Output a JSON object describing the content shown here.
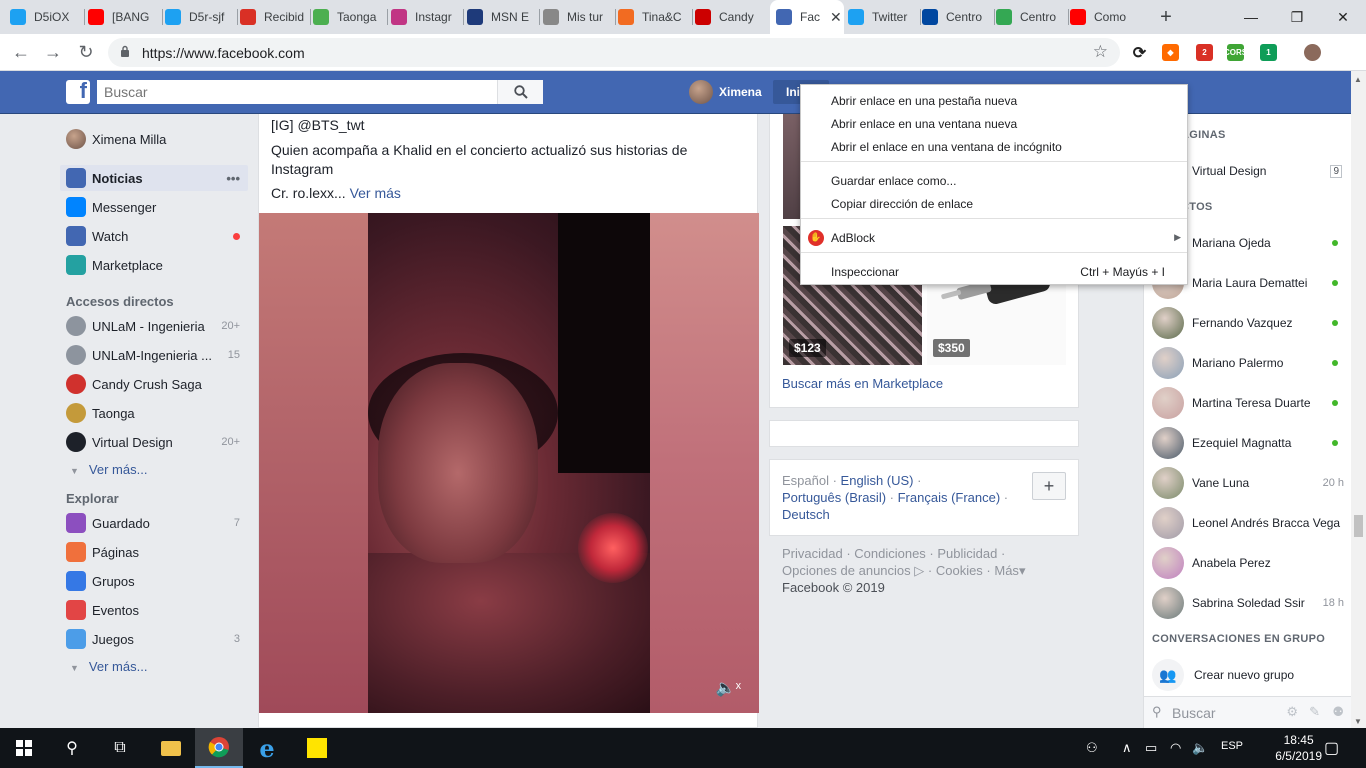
{
  "browser": {
    "tabs": [
      {
        "title": "D5iOX",
        "icon": "twitter-icon",
        "color": "#1da1f2"
      },
      {
        "title": "[BANG",
        "icon": "youtube-icon",
        "color": "#ff0000"
      },
      {
        "title": "D5r-sjf",
        "icon": "twitter-icon",
        "color": "#1da1f2"
      },
      {
        "title": "Recibid",
        "icon": "gmail-icon",
        "color": "#d93025"
      },
      {
        "title": "Taonga",
        "icon": "taonga-icon",
        "color": "#4caf50"
      },
      {
        "title": "Instagr",
        "icon": "instagram-icon",
        "color": "#c13584"
      },
      {
        "title": "MSN E",
        "icon": "msn-icon",
        "color": "#1e3a7a"
      },
      {
        "title": "Mis tur",
        "icon": "page-icon",
        "color": "#888888"
      },
      {
        "title": "Tina&C",
        "icon": "tina-icon",
        "color": "#f26b21"
      },
      {
        "title": "Candy",
        "icon": "santander-icon",
        "color": "#cc0000"
      },
      {
        "title": "Fac",
        "icon": "facebook-icon",
        "color": "#4267b2",
        "active": true,
        "close": "✕"
      },
      {
        "title": "Twitter",
        "icon": "twitter-icon",
        "color": "#1da1f2"
      },
      {
        "title": "Centro",
        "icon": "korea-icon",
        "color": "#0047a0"
      },
      {
        "title": "Centro",
        "icon": "maps-icon",
        "color": "#34a853"
      },
      {
        "title": "Como",
        "icon": "youtube-icon",
        "color": "#ff0000"
      }
    ],
    "new_tab": "+",
    "window_controls": {
      "minimize": "—",
      "maximize": "❐",
      "close": "✕"
    },
    "url": "https://www.facebook.com",
    "extensions": [
      {
        "name": "sync-icon",
        "color": "#222222",
        "label": "⟳"
      },
      {
        "name": "orange-ext-icon",
        "color": "#ff6a00",
        "label": "◆"
      },
      {
        "name": "red-ext-icon",
        "color": "#d93025",
        "label": "2"
      },
      {
        "name": "cors-icon",
        "color": "#3fa535",
        "label": "CORS"
      },
      {
        "name": "green-ext-icon",
        "color": "#0f9d58",
        "label": "1"
      },
      {
        "name": "profile-avatar-icon",
        "color": "#8b6a5c",
        "label": ""
      }
    ]
  },
  "fb": {
    "search_placeholder": "Buscar",
    "profile_name": "Ximena",
    "home_label": "Inicio"
  },
  "leftnav": {
    "user": "Ximena Milla",
    "main": [
      {
        "label": "Noticias",
        "icon": "newsfeed-icon",
        "color": "#4267b2",
        "extra": "•••",
        "selected": true
      },
      {
        "label": "Messenger",
        "icon": "messenger-icon",
        "color": "#0084ff"
      },
      {
        "label": "Watch",
        "icon": "watch-icon",
        "color": "#4267b2",
        "dot": true
      },
      {
        "label": "Marketplace",
        "icon": "marketplace-icon",
        "color": "#24a1a1"
      }
    ],
    "shortcuts_title": "Accesos directos",
    "shortcuts": [
      {
        "label": "UNLaM - Ingenieria",
        "icon": "group-icon",
        "color": "#8d949e",
        "count": "20+"
      },
      {
        "label": "UNLaM-Ingenieria ...",
        "icon": "group-icon",
        "color": "#8d949e",
        "count": "15"
      },
      {
        "label": "Candy Crush Saga",
        "icon": "candy-crush-icon",
        "color": "#d0312d"
      },
      {
        "label": "Taonga",
        "icon": "taonga-icon",
        "color": "#c49a3a"
      },
      {
        "label": "Virtual Design",
        "icon": "virtual-design-icon",
        "color": "#1d2129",
        "count": "20+"
      }
    ],
    "ver_mas": "Ver más...",
    "explore_title": "Explorar",
    "explore": [
      {
        "label": "Guardado",
        "icon": "saved-icon",
        "color": "#8c4fbf",
        "count": "7"
      },
      {
        "label": "Páginas",
        "icon": "pages-icon",
        "color": "#f0703c"
      },
      {
        "label": "Grupos",
        "icon": "groups-icon",
        "color": "#3578e5"
      },
      {
        "label": "Eventos",
        "icon": "events-icon",
        "color": "#e24545"
      },
      {
        "label": "Juegos",
        "icon": "games-icon",
        "color": "#4c9de8",
        "count": "3"
      }
    ],
    "ver_mas2": "Ver más..."
  },
  "post": {
    "line1": "[IG] @BTS_twt",
    "line2": "Quien acompaña a Khalid en el concierto actualizó sus historias de Instagram",
    "line3": "Cr. ro.lexx...",
    "more": "Ver más"
  },
  "marketplace": {
    "prices": [
      "$123",
      "$350"
    ],
    "link": "Buscar más en Marketplace"
  },
  "languages": {
    "current": "Español",
    "links": [
      "English (US)",
      "Português (Brasil)",
      "Français (France)",
      "Deutsch"
    ],
    "plus": "+"
  },
  "footer": {
    "links": [
      "Privacidad",
      "Condiciones",
      "Publicidad",
      "Opciones de anuncios",
      "Cookies",
      "Más"
    ],
    "copyright": "Facebook © 2019"
  },
  "rightbar": {
    "pages_title": "ÁGINAS",
    "page": {
      "name": "Virtual Design",
      "count": "9"
    },
    "contacts_title": "CTOS",
    "contacts": [
      {
        "name": "Mariana Ojeda",
        "online": true
      },
      {
        "name": "Maria Laura Demattei",
        "online": true
      },
      {
        "name": "Fernando Vazquez",
        "online": true
      },
      {
        "name": "Mariano Palermo",
        "online": true
      },
      {
        "name": "Martina Teresa Duarte",
        "online": true
      },
      {
        "name": "Ezequiel Magnatta",
        "online": true
      },
      {
        "name": "Vane Luna",
        "time": "20 h"
      },
      {
        "name": "Leonel Andrés Bracca Vega"
      },
      {
        "name": "Anabela Perez"
      },
      {
        "name": "Sabrina Soledad Ssir",
        "time": "18 h"
      }
    ],
    "group_title": "CONVERSACIONES EN GRUPO",
    "create_group": "Crear nuevo grupo",
    "chat_search": "Buscar"
  },
  "context_menu": {
    "items": [
      {
        "label": "Abrir enlace en una pestaña nueva"
      },
      {
        "label": "Abrir enlace en una ventana nueva"
      },
      {
        "label": "Abrir el enlace en una ventana de incógnito"
      },
      {
        "label": "Guardar enlace como..."
      },
      {
        "label": "Copiar dirección de enlace"
      },
      {
        "label": "AdBlock",
        "submenu": "▶"
      },
      {
        "label": "Inspeccionar",
        "shortcut": "Ctrl + Mayús + I"
      }
    ]
  },
  "taskbar": {
    "lang": "ESP",
    "time": "18:45",
    "date": "6/5/2019"
  }
}
